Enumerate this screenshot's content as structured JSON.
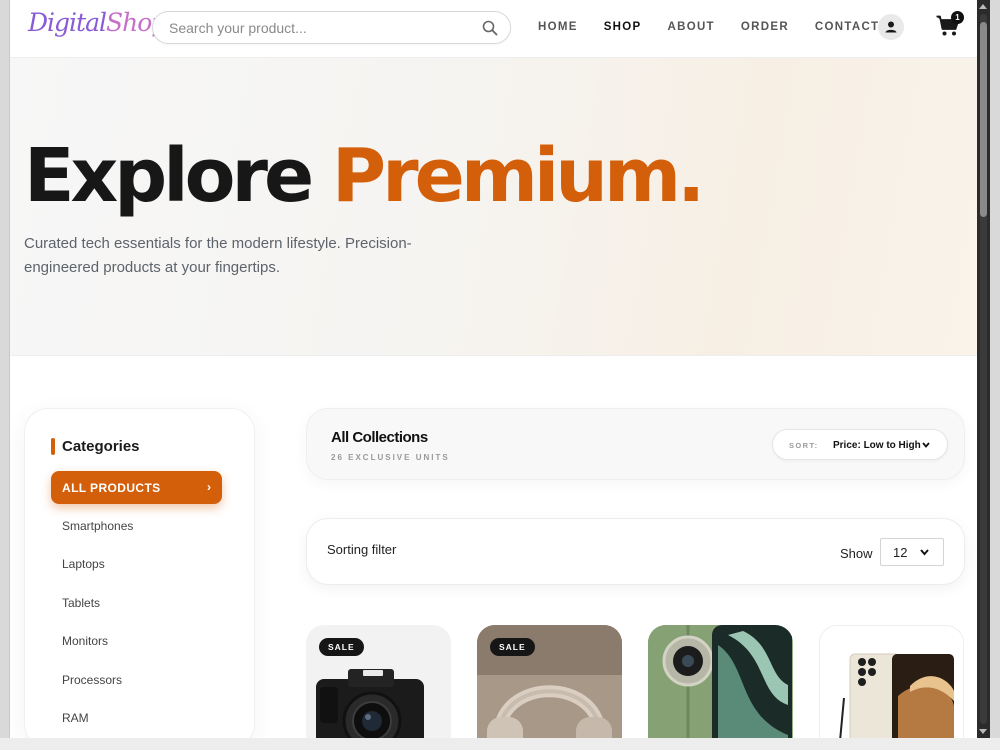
{
  "brand": {
    "part1": "Digital",
    "part2": "Shop"
  },
  "search": {
    "placeholder": "Search your product..."
  },
  "menu": [
    {
      "label": "HOME"
    },
    {
      "label": "SHOP"
    },
    {
      "label": "ABOUT"
    },
    {
      "label": "ORDER"
    },
    {
      "label": "CONTACT"
    }
  ],
  "cart": {
    "count": "1"
  },
  "hero": {
    "title_part1": "Explore ",
    "title_part2": "Premium.",
    "subtitle": "Curated tech essentials for the modern lifestyle. Precision-engineered products at your fingertips."
  },
  "sidebar": {
    "heading": "Categories",
    "active": "ALL PRODUCTS",
    "active_chevron": "›",
    "items": [
      {
        "label": "Smartphones"
      },
      {
        "label": "Laptops"
      },
      {
        "label": "Tablets"
      },
      {
        "label": "Monitors"
      },
      {
        "label": "Processors"
      },
      {
        "label": "RAM"
      }
    ]
  },
  "collections": {
    "title": "All Collections",
    "units": "26 EXCLUSIVE UNITS",
    "sort_label": "SORT:",
    "sort_value": "Price: Low to High"
  },
  "filter": {
    "title": "Sorting filter",
    "show_label": "Show",
    "show_value": "12"
  },
  "products": [
    {
      "badge": "SALE"
    },
    {
      "badge": "SALE"
    },
    {
      "badge": ""
    },
    {
      "badge": ""
    }
  ],
  "colors": {
    "accent": "#d45f0a",
    "dark": "#161616"
  }
}
